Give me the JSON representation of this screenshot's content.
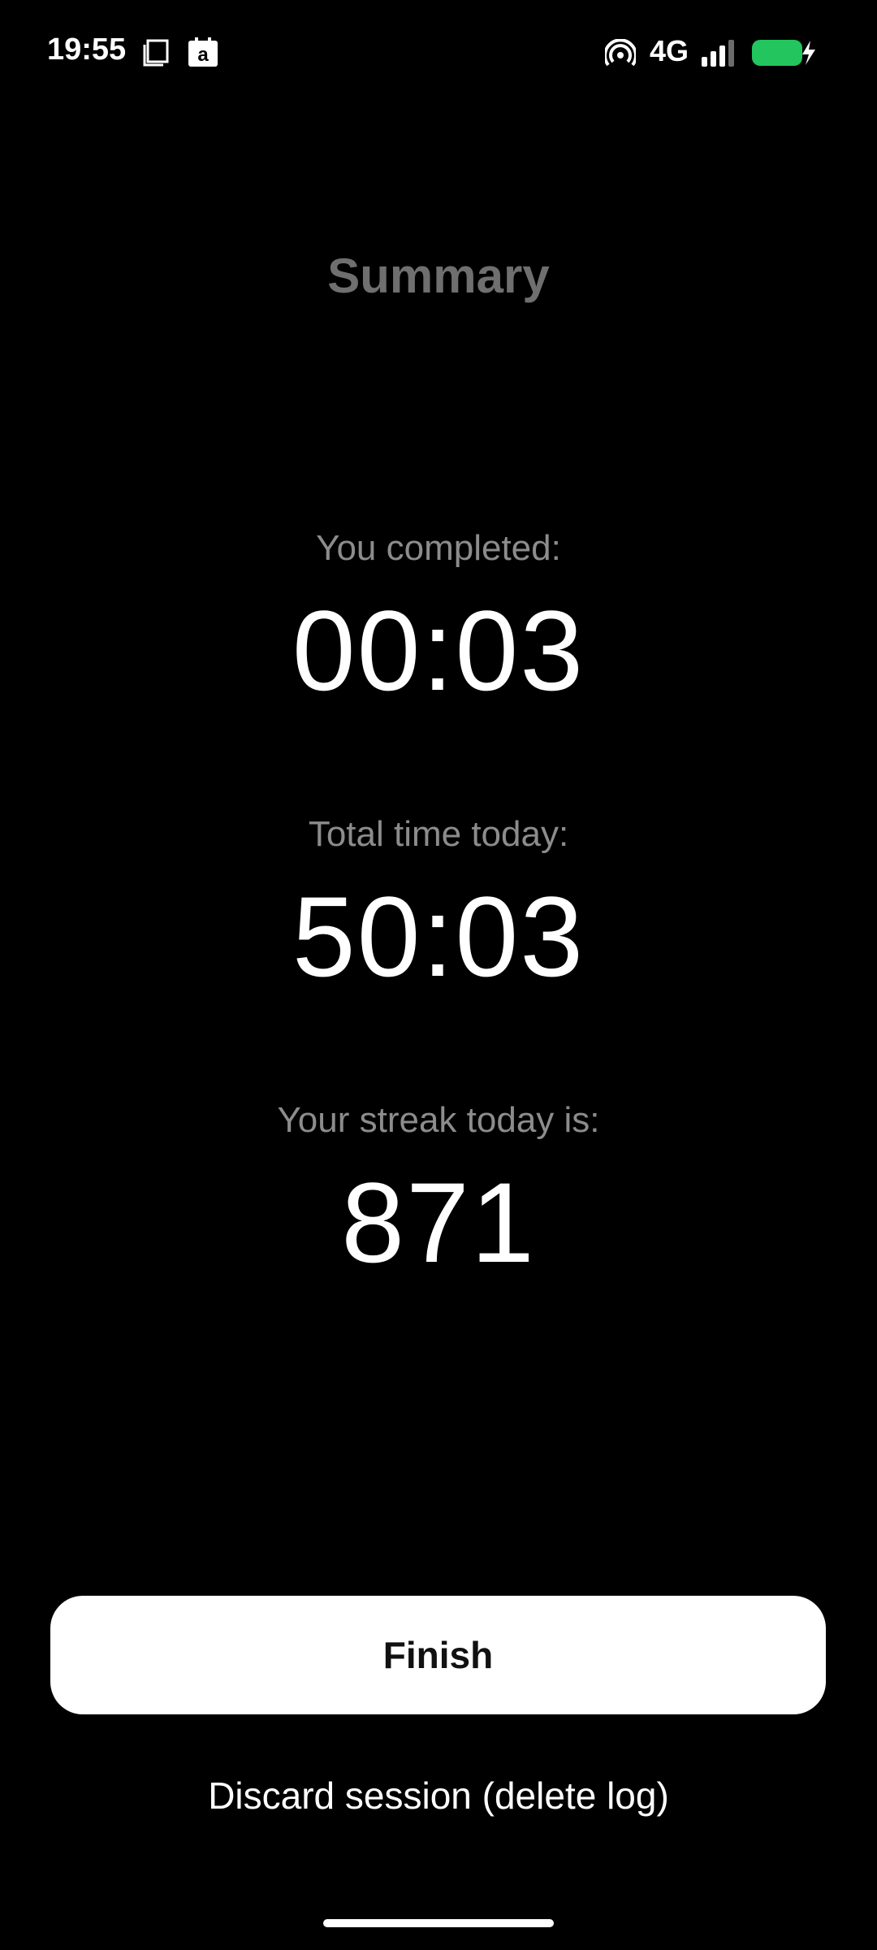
{
  "status_bar": {
    "time": "19:55",
    "network": "4G",
    "icons": [
      "screen-record-icon",
      "amazon-app-icon",
      "hotspot-icon",
      "signal-icon",
      "battery-charging-icon"
    ],
    "battery_color": "#22c55e"
  },
  "title": "Summary",
  "stats": [
    {
      "label": "You completed:",
      "value": "00:03"
    },
    {
      "label": "Total time today:",
      "value": "50:03"
    },
    {
      "label": "Your streak today is:",
      "value": "871"
    }
  ],
  "actions": {
    "finish_label": "Finish",
    "discard_label": "Discard session (delete log)"
  },
  "colors": {
    "background": "#000000",
    "title": "#6f6f6f",
    "label": "#8c8c8c",
    "primary_button": "#ffffff"
  }
}
